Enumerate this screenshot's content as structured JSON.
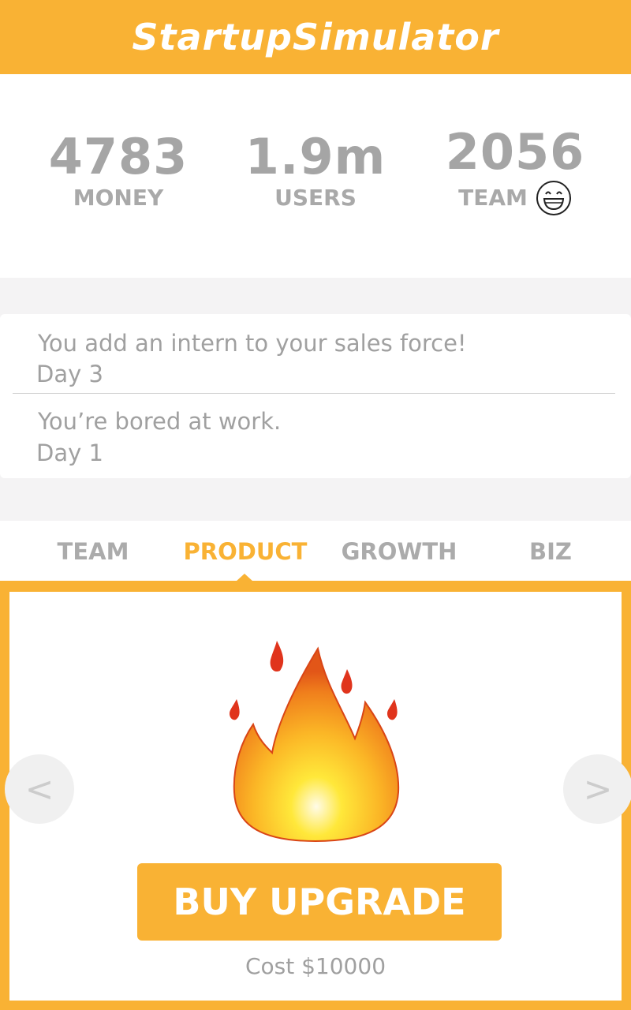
{
  "app": {
    "title": "StartupSimulator"
  },
  "stats": {
    "money": {
      "value": "4783",
      "label": "MONEY"
    },
    "users": {
      "value": "1.9m",
      "label": "USERS"
    },
    "team": {
      "value": "2056",
      "label": "TEAM",
      "mood_icon": "smiley-face-icon"
    }
  },
  "feed": [
    {
      "message": "You add an intern to your sales force!",
      "day": "Day 3"
    },
    {
      "message": "You’re bored at work.",
      "day": "Day 1"
    }
  ],
  "tabs": [
    {
      "label": "TEAM",
      "active": false
    },
    {
      "label": "PRODUCT",
      "active": true
    },
    {
      "label": "GROWTH",
      "active": false
    },
    {
      "label": "BIZ",
      "active": false
    }
  ],
  "upgrade": {
    "icon": "fire-icon",
    "prev_label": "<",
    "next_label": ">",
    "buy_label": "BUY UPGRADE",
    "cost_text": "Cost $10000"
  },
  "colors": {
    "accent": "#f9b234",
    "muted_text": "#a5a5a5",
    "feed_background": "#f4f3f4"
  }
}
